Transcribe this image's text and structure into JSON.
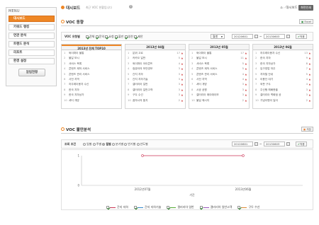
{
  "sidebar": {
    "title": "MENU",
    "items": [
      {
        "label": "대시보드",
        "active": true
      },
      {
        "label": "키워드 랭킹",
        "active": false
      },
      {
        "label": "연관 분석",
        "active": false
      },
      {
        "label": "트랜드 분석",
        "active": false
      },
      {
        "label": "리포트",
        "active": false
      },
      {
        "label": "환경 설정",
        "active": false
      }
    ],
    "button_label": "알림현황"
  },
  "header": {
    "title": "대시보드",
    "subtitle": "최근 VOC 현황입니다",
    "home_label": "대시보드",
    "print_label": "화면인쇄"
  },
  "voc_trend": {
    "title": "VOC 동향",
    "excel_label": "Excel",
    "filter_label": "VOC 유형별",
    "checkboxes": [
      {
        "label": "전체",
        "checked": true
      },
      {
        "label": "문의",
        "checked": true
      },
      {
        "label": "요청",
        "checked": true
      },
      {
        "label": "불만",
        "checked": true
      },
      {
        "label": "칭찬",
        "checked": true
      },
      {
        "label": "제안",
        "checked": true
      }
    ],
    "period_select": "월별",
    "date_from": "20120601",
    "date_sep": "~",
    "date_to": "20130603",
    "apply_label": "적용",
    "columns": [
      {
        "header": "2013년 전체 TOP10",
        "rows": [
          {
            "num": "1",
            "text": "와이파이 불통",
            "count": "",
            "arrow": ""
          },
          {
            "num": "2",
            "text": "불일 보시",
            "count": "",
            "arrow": ""
          },
          {
            "num": "3",
            "text": "서비스 목록",
            "count": "",
            "arrow": ""
          },
          {
            "num": "4",
            "text": "콘텐츠 제작 서비스",
            "count": "",
            "arrow": ""
          },
          {
            "num": "5",
            "text": "콘텐츠 관리 서비스",
            "count": "",
            "arrow": ""
          },
          {
            "num": "6",
            "text": "사전 지역",
            "count": "",
            "arrow": ""
          },
          {
            "num": "7",
            "text": "하우레이용자 수신",
            "count": "",
            "arrow": ""
          },
          {
            "num": "8",
            "text": "한국 지하",
            "count": "",
            "arrow": ""
          },
          {
            "num": "9",
            "text": "한국 지하상가",
            "count": "",
            "arrow": ""
          },
          {
            "num": "10",
            "text": "셔터 개방",
            "count": "",
            "arrow": ""
          }
        ]
      },
      {
        "header": "2013년 04월",
        "rows": [
          {
            "num": "1",
            "text": "분위 고르",
            "count": "17",
            "arrow": "▲"
          },
          {
            "num": "2",
            "text": "카카오 일반",
            "count": "5",
            "arrow": "▲"
          },
          {
            "num": "3",
            "text": "와이파이 아이콘뜨",
            "count": "4",
            "arrow": "▲"
          },
          {
            "num": "4",
            "text": "컴퓨터의 보안영보",
            "count": "3",
            "arrow": "▲"
          },
          {
            "num": "5",
            "text": "간지 지하",
            "count": "3",
            "arrow": "▲"
          },
          {
            "num": "6",
            "text": "간지 지하기술",
            "count": "3",
            "arrow": "▲"
          },
          {
            "num": "7",
            "text": "갤러리아 일반",
            "count": "3",
            "arrow": "▲"
          },
          {
            "num": "8",
            "text": "갤러리아 일반고객",
            "count": "3",
            "arrow": "▲"
          },
          {
            "num": "9",
            "text": "구두 수선",
            "count": "3",
            "arrow": "▲"
          },
          {
            "num": "10",
            "text": "꼽하시의 통지",
            "count": "2",
            "arrow": "▲"
          }
        ]
      },
      {
        "header": "2013년 05월",
        "rows": [
          {
            "num": "1",
            "text": "와이파이 불통",
            "count": "17",
            "arrow": "▲"
          },
          {
            "num": "2",
            "text": "불일 보시",
            "count": "11",
            "arrow": "▲"
          },
          {
            "num": "3",
            "text": "서비스 목록",
            "count": "5",
            "arrow": "▲"
          },
          {
            "num": "4",
            "text": "콘텐츠 제작 서비스",
            "count": "5",
            "arrow": "▲"
          },
          {
            "num": "5",
            "text": "콘텐츠 관리 서비스",
            "count": "4",
            "arrow": "▲"
          },
          {
            "num": "6",
            "text": "사전 지역",
            "count": "4",
            "arrow": "▲"
          },
          {
            "num": "7",
            "text": "셔터 개방",
            "count": "3",
            "arrow": "▲"
          },
          {
            "num": "8",
            "text": "시공 공원",
            "count": "3",
            "arrow": "▲"
          },
          {
            "num": "9",
            "text": "갤러리아 에이에이보",
            "count": "3",
            "arrow": "▲"
          },
          {
            "num": "10",
            "text": "불일 메시지",
            "count": "2",
            "arrow": "▲"
          }
        ]
      },
      {
        "header": "2013년 06월",
        "rows": [
          {
            "num": "1",
            "text": "하우레이용자 수신",
            "count": "13",
            "arrow": "▲"
          },
          {
            "num": "2",
            "text": "한국 지하",
            "count": "9",
            "arrow": "▲"
          },
          {
            "num": "3",
            "text": "한국 지하상가",
            "count": "8",
            "arrow": "▲"
          },
          {
            "num": "4",
            "text": "입구영업 하우",
            "count": "7",
            "arrow": "▲"
          },
          {
            "num": "5",
            "text": "지하철 안내",
            "count": "5",
            "arrow": "▲"
          },
          {
            "num": "6",
            "text": "이용인 대기",
            "count": "4",
            "arrow": "▲"
          },
          {
            "num": "7",
            "text": "외판 구두",
            "count": "4",
            "arrow": "▲"
          },
          {
            "num": "8",
            "text": "주신행 해배총을",
            "count": "3",
            "arrow": "▲"
          },
          {
            "num": "9",
            "text": "갤러리아 백화점 공",
            "count": "3",
            "arrow": "▲"
          },
          {
            "num": "10",
            "text": "기념이벤이 일어",
            "count": "2",
            "arrow": "▲"
          }
        ]
      }
    ]
  },
  "voc_complaint": {
    "title": "VOC 불만분석",
    "save_label": "저장",
    "filter_label": "조회 조건",
    "radios": [
      {
        "label": "일별",
        "on": false
      },
      {
        "label": "주별",
        "on": false
      },
      {
        "label": "월별",
        "on": true
      },
      {
        "label": "분기별",
        "on": false
      },
      {
        "label": "반기별",
        "on": false
      },
      {
        "label": "년도별",
        "on": false
      }
    ],
    "date_from": "20120601",
    "date_sep": "~",
    "date_to": "20130603",
    "apply_label": "적용"
  },
  "chart_data": {
    "type": "line",
    "x": [
      "2012년07월",
      "2013년06월"
    ],
    "xlabel": "기간",
    "ylabel": "",
    "ylim": [
      0,
      1
    ],
    "yticks": [
      "0",
      "1"
    ],
    "series": [
      {
        "name": "간지 지하",
        "color": "#cc3355",
        "values": [
          1,
          1
        ]
      }
    ],
    "legend": [
      {
        "label": "간지 지하",
        "color": "#cc3355",
        "checked": true
      },
      {
        "label": "간지 지하기술",
        "color": "#3388cc",
        "checked": true
      },
      {
        "label": "갤러리아 일반",
        "color": "#55aa33",
        "checked": true
      },
      {
        "label": "갤러리아 일반고객",
        "color": "#9955bb",
        "checked": true
      },
      {
        "label": "구두 수선",
        "color": "#dd8833",
        "checked": true
      }
    ]
  }
}
